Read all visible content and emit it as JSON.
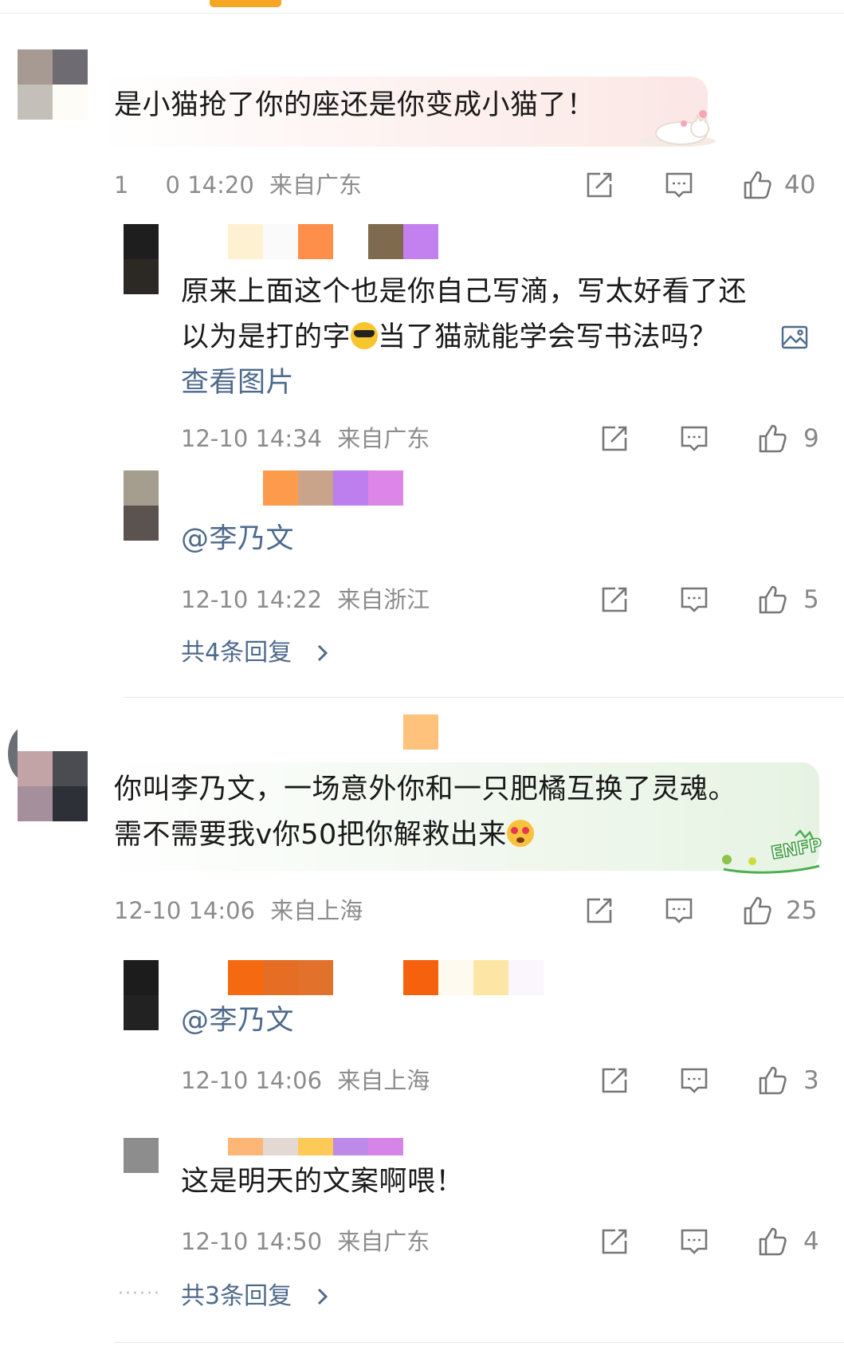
{
  "colors": {
    "accent_bar": "#f5a623",
    "link": "#4e6a8c",
    "meta_gray": "#8c8c8c"
  },
  "icons": {
    "share": "share-icon",
    "comment": "comment-icon",
    "like": "like-icon",
    "image": "image-icon",
    "chevron": "chevron-right-icon"
  },
  "comments": [
    {
      "text": "是小猫抢了你的座还是你变成小猫了！",
      "time": "1     0 14:20",
      "location": "来自广东",
      "likes": "40",
      "bubble": "cat-sticker",
      "replies": [
        {
          "line1": "原来上面这个也是你自己写滴，写太好看了还",
          "line2a": "以为是打的字",
          "line2b": "当了猫就能学会写书法吗？",
          "link": "查看图片",
          "time": "12-10 14:34",
          "location": "来自广东",
          "likes": "9"
        },
        {
          "text": "@李乃文",
          "time": "12-10 14:22",
          "location": "来自浙江",
          "likes": "5"
        }
      ],
      "more_replies": "共4条回复"
    },
    {
      "line1": "你叫李乃文，一场意外你和一只肥橘互换了灵魂。",
      "line2": "需不需要我v你50把你解救出来",
      "time": "12-10 14:06",
      "location": "来自上海",
      "likes": "25",
      "sticker_text": "ENFP",
      "replies": [
        {
          "text": "@李乃文",
          "time": "12-10 14:06",
          "location": "来自上海",
          "likes": "3"
        },
        {
          "text": "这是明天的文案啊喂！",
          "time": "12-10 14:50",
          "location": "来自广东",
          "likes": "4"
        }
      ],
      "more_replies": "共3条回复"
    }
  ]
}
